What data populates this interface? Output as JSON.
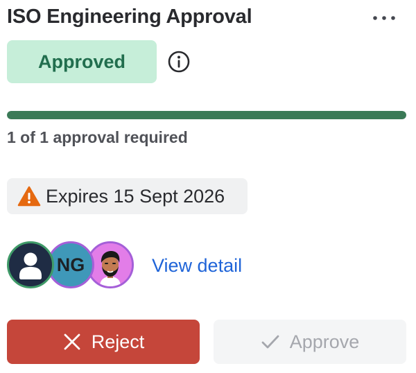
{
  "card": {
    "title": "ISO Engineering Approval",
    "more_icon": "more-horizontal-icon",
    "status": {
      "label": "Approved",
      "bg_color": "#c6eed9",
      "text_color": "#216e4e"
    },
    "info_icon": "info-icon"
  },
  "progress": {
    "value": 1.0,
    "fill_color": "#3b7a57",
    "text": "1 of 1 approval required"
  },
  "expiry": {
    "icon": "warning-icon",
    "icon_color": "#e56910",
    "text": "Expires 15 Sept 2026"
  },
  "approvers": {
    "avatars": [
      {
        "type": "default-user-icon",
        "ring_color": "#3f9a68"
      },
      {
        "initials": "NG",
        "bg_color": "#3f98b9",
        "ring_color": "#a45fd8"
      },
      {
        "type": "user-photo-illustration",
        "bg_color": "#e27de8",
        "ring_color": "#a45fd8"
      }
    ],
    "view_detail_label": "View detail"
  },
  "actions": {
    "reject_label": "Reject",
    "reject_icon": "close-icon",
    "reject_color": "#c5463a",
    "approve_label": "Approve",
    "approve_icon": "check-icon"
  }
}
